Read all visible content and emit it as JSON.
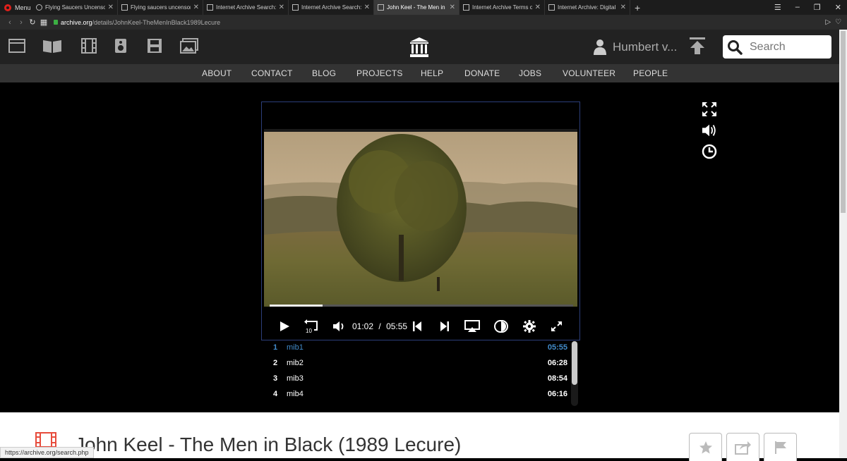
{
  "browser": {
    "menu_label": "Menu",
    "tabs": [
      {
        "title": "Flying Saucers Uncensored",
        "active": false
      },
      {
        "title": "Flying saucers uncensored",
        "active": false
      },
      {
        "title": "Internet Archive Search: c",
        "active": false
      },
      {
        "title": "Internet Archive Search: c",
        "active": false
      },
      {
        "title": "John Keel - The Men in Bl",
        "active": true
      },
      {
        "title": "Internet Archive Terms of U",
        "active": false
      },
      {
        "title": "Internet Archive: Digital Lib",
        "active": false
      }
    ],
    "url_host": "archive.org",
    "url_path": "/details/JohnKeel-TheMenInBlack1989Lecure",
    "status_url": "https://archive.org/search.php"
  },
  "archive_nav": {
    "media_icons": [
      "web-icon",
      "texts-icon",
      "video-icon",
      "audio-icon",
      "software-icon",
      "images-icon"
    ],
    "user_name": "Humbert v...",
    "search_placeholder": "Search",
    "links": [
      "ABOUT",
      "CONTACT",
      "BLOG",
      "PROJECTS",
      "HELP",
      "DONATE",
      "JOBS",
      "VOLUNTEER",
      "PEOPLE"
    ]
  },
  "player": {
    "current_time": "01:02",
    "separator": "/",
    "total_time": "05:55",
    "progress": 0.175,
    "skip_label": "10"
  },
  "playlist": [
    {
      "num": "1",
      "name": "mib1",
      "duration": "05:55",
      "active": true
    },
    {
      "num": "2",
      "name": "mib2",
      "duration": "06:28",
      "active": false
    },
    {
      "num": "3",
      "name": "mib3",
      "duration": "08:54",
      "active": false
    },
    {
      "num": "4",
      "name": "mib4",
      "duration": "06:16",
      "active": false
    }
  ],
  "item": {
    "title": "John Keel - The Men in Black (1989 Lecure)"
  },
  "colors": {
    "accent": "#428bca",
    "title_icon": "#e74c3c",
    "nav_bg": "#222222",
    "subnav_bg": "#333333"
  }
}
